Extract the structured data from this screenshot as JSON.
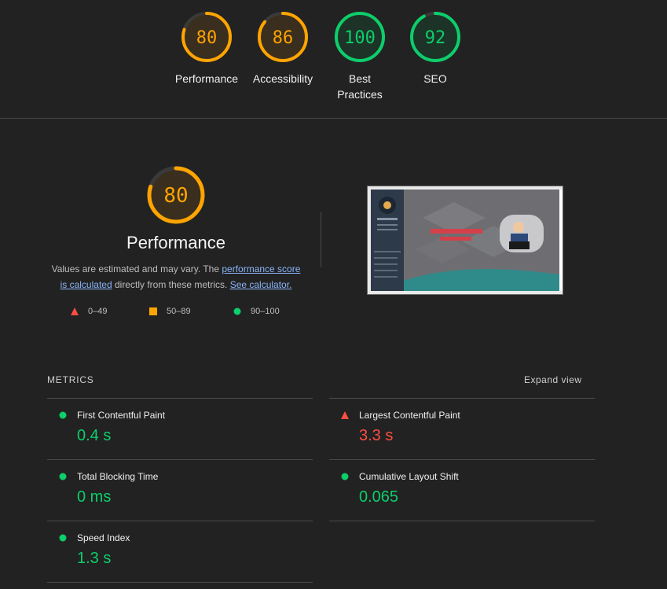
{
  "gauges": [
    {
      "score": "80",
      "label": "Performance",
      "color": "#ffa400",
      "fraction": 0.8
    },
    {
      "score": "86",
      "label": "Accessibility",
      "color": "#ffa400",
      "fraction": 0.86
    },
    {
      "score": "100",
      "label": "Best Practices",
      "color": "#0cce6b",
      "fraction": 1.0
    },
    {
      "score": "92",
      "label": "SEO",
      "color": "#0cce6b",
      "fraction": 0.92
    }
  ],
  "performance": {
    "score": "80",
    "fraction": 0.8,
    "title": "Performance",
    "desc_prefix": "Values are estimated and may vary. The ",
    "link_score": "performance score is calculated",
    "desc_middle": " directly from these metrics. ",
    "link_calc": "See calculator.",
    "legend": [
      {
        "range": "0–49",
        "shape": "triangle",
        "color": "#ff4e42"
      },
      {
        "range": "50–89",
        "shape": "square",
        "color": "#ffa400"
      },
      {
        "range": "90–100",
        "shape": "circle",
        "color": "#0cce6b"
      }
    ]
  },
  "metrics": {
    "heading": "METRICS",
    "expand_label": "Expand view",
    "items": [
      {
        "name": "First Contentful Paint",
        "value": "0.4 s",
        "status": "pass"
      },
      {
        "name": "Largest Contentful Paint",
        "value": "3.3 s",
        "status": "fail"
      },
      {
        "name": "Total Blocking Time",
        "value": "0 ms",
        "status": "pass"
      },
      {
        "name": "Cumulative Layout Shift",
        "value": "0.065",
        "status": "pass"
      },
      {
        "name": "Speed Index",
        "value": "1.3 s",
        "status": "pass"
      }
    ]
  },
  "colors": {
    "pass": "#0cce6b",
    "average": "#ffa400",
    "fail": "#ff4e42"
  }
}
